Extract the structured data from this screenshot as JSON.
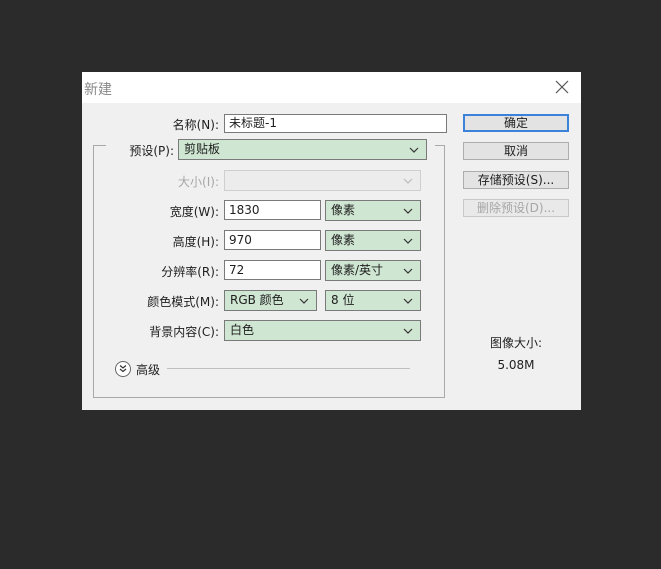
{
  "dialog": {
    "title": "新建",
    "fields": {
      "name": {
        "label": "名称(N):",
        "value": "未标题-1"
      },
      "preset": {
        "label": "预设(P):",
        "value": "剪贴板"
      },
      "size": {
        "label": "大小(I):",
        "value": ""
      },
      "width": {
        "label": "宽度(W):",
        "value": "1830",
        "unit": "像素"
      },
      "height": {
        "label": "高度(H):",
        "value": "970",
        "unit": "像素"
      },
      "resolution": {
        "label": "分辨率(R):",
        "value": "72",
        "unit": "像素/英寸"
      },
      "color_mode": {
        "label": "颜色模式(M):",
        "value": "RGB 颜色",
        "bits": "8 位"
      },
      "background": {
        "label": "背景内容(C):",
        "value": "白色"
      }
    },
    "advanced": {
      "label": "高级"
    },
    "buttons": {
      "ok": "确定",
      "cancel": "取消",
      "save_preset": "存储预设(S)...",
      "delete_preset": "删除预设(D)..."
    },
    "image_size": {
      "label": "图像大小:",
      "value": "5.08M"
    }
  },
  "colors": {
    "background": "#2b2b2b",
    "dialog": "#f0f0f0",
    "select_fill": "#cfe6d2",
    "primary_border": "#3b82d8"
  }
}
